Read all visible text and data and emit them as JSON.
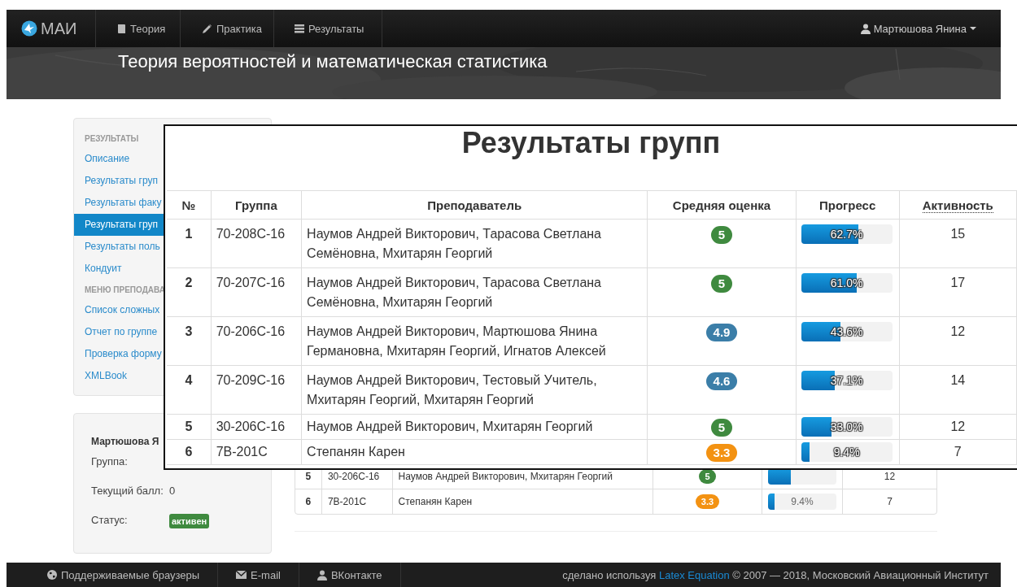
{
  "navbar": {
    "brand": "МАИ",
    "items": [
      {
        "label": "Теория"
      },
      {
        "label": "Практика"
      },
      {
        "label": "Результаты"
      }
    ],
    "user": "Мартюшова Янина"
  },
  "banner": {
    "title": "Теория вероятностей и математическая статистика"
  },
  "sidebar": {
    "sections": [
      {
        "heading": "РЕЗУЛЬТАТЫ",
        "items": [
          {
            "label": "Описание",
            "selected": false
          },
          {
            "label": "Результаты груп",
            "selected": false
          },
          {
            "label": "Результаты факу",
            "selected": false
          },
          {
            "label": "Результаты груп",
            "selected": true
          },
          {
            "label": "Результаты поль",
            "selected": false
          },
          {
            "label": "Кондуит",
            "selected": false
          }
        ]
      },
      {
        "heading": "МЕНЮ ПРЕПОДАВА",
        "items": [
          {
            "label": "Список сложных",
            "selected": false
          },
          {
            "label": "Отчет по группе",
            "selected": false
          },
          {
            "label": "Проверка форму",
            "selected": false
          },
          {
            "label": "XMLBook",
            "selected": false
          }
        ]
      }
    ]
  },
  "profile": {
    "name": "Мартюшова Я",
    "fields": [
      {
        "label": "Группа:",
        "kind": "text"
      },
      {
        "label": "Текущий балл:",
        "kind": "text",
        "value": "0"
      },
      {
        "label": "Статус:",
        "kind": "badge",
        "value": "активен"
      }
    ]
  },
  "results_table": {
    "rows": [
      {
        "number": "5",
        "group": "30-206С-16",
        "teacher": "Наумов Андрей Викторович, Мхитарян Георгий",
        "grade": "5",
        "color": "#3f8a3f",
        "level": 0.33,
        "activity": "12"
      },
      {
        "number": "6",
        "group": "7В-201С",
        "teacher": "Степанян Карен",
        "grade": "3.3",
        "color": "#f39212",
        "progress": "9.4%",
        "level": 0.094,
        "activity": "7"
      }
    ]
  },
  "zoom_overlay": {
    "title": "Результаты групп",
    "columns": [
      "№",
      "Группа",
      "Преподаватель",
      "Средняя оценка",
      "Прогресс",
      "Активность"
    ],
    "rows": [
      {
        "number": "1",
        "group": "70-208С-16",
        "teacher": "Наумов Андрей Викторович, Тарасова Светлана Семёновна, Мхитарян Георгий",
        "grade": "5",
        "color": "#3f8a3f",
        "progress": "62.7%",
        "level": 0.627,
        "activity": "15"
      },
      {
        "number": "2",
        "group": "70-207С-16",
        "teacher": "Наумов Андрей Викторович, Тарасова Светлана Семёновна, Мхитарян Георгий",
        "grade": "5",
        "color": "#3f8a3f",
        "progress": "61.0%",
        "level": 0.61,
        "activity": "17"
      },
      {
        "number": "3",
        "group": "70-206С-16",
        "teacher": "Наумов Андрей Викторович, Мартюшова Янина Германовна, Мхитарян Георгий, Игнатов Алексей",
        "grade": "4.9",
        "color": "#3b7ea8",
        "progress": "43.6%",
        "level": 0.436,
        "activity": "12"
      },
      {
        "number": "4",
        "group": "70-209С-16",
        "teacher": "Наумов Андрей Викторович, Тестовый Учитель, Мхитарян Георгий, Мхитарян Георгий",
        "grade": "4.6",
        "color": "#3b7ea8",
        "progress": "37.1%",
        "level": 0.371,
        "activity": "14"
      },
      {
        "number": "5",
        "group": "30-206С-16",
        "teacher": "Наумов Андрей Викторович, Мхитарян Георгий",
        "grade": "5",
        "color": "#3f8a3f",
        "progress": "33.0%",
        "level": 0.33,
        "activity": "12"
      },
      {
        "number": "6",
        "group": "7В-201С",
        "teacher": "Степанян Карен",
        "grade": "3.3",
        "color": "#f39212",
        "progress": "9.4%",
        "level": 0.094,
        "activity": "7"
      }
    ]
  },
  "footer": {
    "links": [
      "Поддерживаемые браузеры",
      "E-mail",
      "ВКонтакте"
    ],
    "credit_before": "сделано используя",
    "credit_link": "Latex Equation",
    "credit_after": "© 2007 — 2018, Московский Авиационный Институт"
  }
}
